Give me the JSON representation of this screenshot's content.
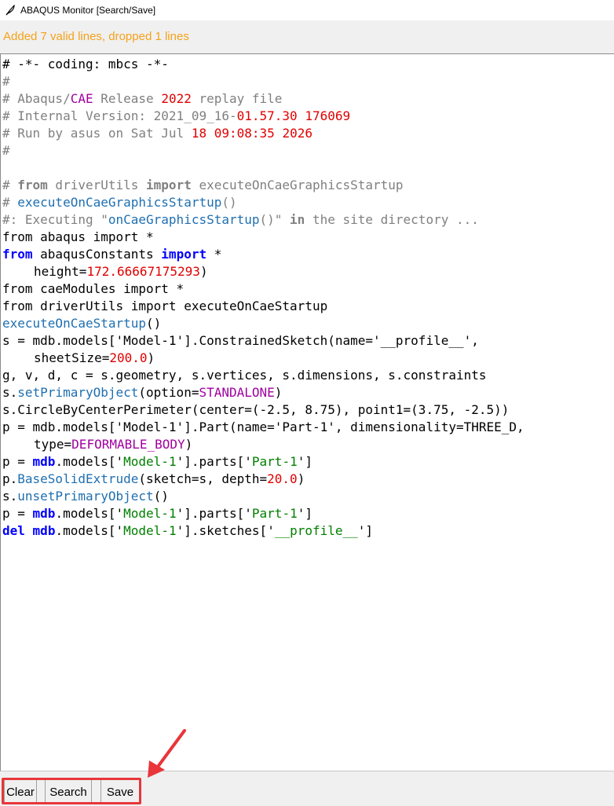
{
  "window": {
    "title": "ABAQUS Monitor [Search/Save]"
  },
  "status": {
    "text": "Added 7 valid lines, dropped 1 lines",
    "color": "#f5a21a"
  },
  "colors": {
    "comment": "#808080",
    "keyword": "#0000ff",
    "string": "#008000",
    "number": "#e00000",
    "function": "#1f6fb0",
    "constant": "#a000a0",
    "highlight_box": "#e8363a"
  },
  "editor": {
    "lines": [
      {
        "indent": false,
        "tokens": [
          {
            "t": "# -*- coding: mbcs -*-",
            "c": "plain"
          }
        ]
      },
      {
        "indent": false,
        "tokens": [
          {
            "t": "#",
            "c": "comment"
          }
        ]
      },
      {
        "indent": false,
        "tokens": [
          {
            "t": "# Abaqus/",
            "c": "comment"
          },
          {
            "t": "CAE",
            "c": "constant"
          },
          {
            "t": " Release ",
            "c": "comment"
          },
          {
            "t": "2022",
            "c": "number"
          },
          {
            "t": " replay file",
            "c": "comment"
          }
        ]
      },
      {
        "indent": false,
        "tokens": [
          {
            "t": "# Internal Version: 2021_09_16-",
            "c": "comment"
          },
          {
            "t": "01.57.30",
            "c": "number"
          },
          {
            "t": " ",
            "c": "comment"
          },
          {
            "t": "176069",
            "c": "number"
          }
        ]
      },
      {
        "indent": false,
        "tokens": [
          {
            "t": "# Run by asus on Sat Jul ",
            "c": "comment"
          },
          {
            "t": "18",
            "c": "number"
          },
          {
            "t": " ",
            "c": "comment"
          },
          {
            "t": "09:08:35",
            "c": "number"
          },
          {
            "t": " ",
            "c": "comment"
          },
          {
            "t": "2026",
            "c": "number"
          }
        ]
      },
      {
        "indent": false,
        "tokens": [
          {
            "t": "#",
            "c": "comment"
          }
        ]
      },
      {
        "indent": false,
        "tokens": [
          {
            "t": "",
            "c": "plain"
          }
        ]
      },
      {
        "indent": false,
        "tokens": [
          {
            "t": "# ",
            "c": "comment"
          },
          {
            "t": "from",
            "c": "comment-kw"
          },
          {
            "t": " driverUtils ",
            "c": "comment"
          },
          {
            "t": "import",
            "c": "comment-kw"
          },
          {
            "t": " executeOnCaeGraphicsStartup",
            "c": "comment"
          }
        ]
      },
      {
        "indent": false,
        "tokens": [
          {
            "t": "# ",
            "c": "comment"
          },
          {
            "t": "executeOnCaeGraphicsStartup",
            "c": "function"
          },
          {
            "t": "()",
            "c": "comment"
          }
        ]
      },
      {
        "indent": false,
        "tokens": [
          {
            "t": "#: Executing \"",
            "c": "comment"
          },
          {
            "t": "onCaeGraphicsStartup",
            "c": "function"
          },
          {
            "t": "()\" ",
            "c": "comment"
          },
          {
            "t": "in",
            "c": "comment-kw"
          },
          {
            "t": " the site directory ...",
            "c": "comment"
          }
        ]
      },
      {
        "indent": false,
        "tokens": [
          {
            "t": "from abaqus import *",
            "c": "plain"
          }
        ]
      },
      {
        "indent": false,
        "tokens": [
          {
            "t": "from",
            "c": "keyword"
          },
          {
            "t": " abaqusConstants ",
            "c": "plain"
          },
          {
            "t": "import",
            "c": "keyword"
          },
          {
            "t": " *",
            "c": "plain"
          }
        ]
      },
      {
        "indent": true,
        "tokens": [
          {
            "t": "height=",
            "c": "plain"
          },
          {
            "t": "172.66667175293",
            "c": "number"
          },
          {
            "t": ")",
            "c": "plain"
          }
        ]
      },
      {
        "indent": false,
        "tokens": [
          {
            "t": "from caeModules import *",
            "c": "plain"
          }
        ]
      },
      {
        "indent": false,
        "tokens": [
          {
            "t": "from driverUtils import executeOnCaeStartup",
            "c": "plain"
          }
        ]
      },
      {
        "indent": false,
        "tokens": [
          {
            "t": "executeOnCaeStartup",
            "c": "function"
          },
          {
            "t": "()",
            "c": "plain"
          }
        ]
      },
      {
        "indent": false,
        "tokens": [
          {
            "t": "s = mdb.models['Model-1'].ConstrainedSketch(name='__profile__',",
            "c": "plain"
          }
        ]
      },
      {
        "indent": true,
        "tokens": [
          {
            "t": "sheetSize=",
            "c": "plain"
          },
          {
            "t": "200.0",
            "c": "number"
          },
          {
            "t": ")",
            "c": "plain"
          }
        ]
      },
      {
        "indent": false,
        "tokens": [
          {
            "t": "g, v, d, c = s.geometry, s.vertices, s.dimensions, s.constraints",
            "c": "plain"
          }
        ]
      },
      {
        "indent": false,
        "tokens": [
          {
            "t": "s.",
            "c": "plain"
          },
          {
            "t": "setPrimaryObject",
            "c": "function"
          },
          {
            "t": "(option=",
            "c": "plain"
          },
          {
            "t": "STANDALONE",
            "c": "constant"
          },
          {
            "t": ")",
            "c": "plain"
          }
        ]
      },
      {
        "indent": false,
        "tokens": [
          {
            "t": "s.CircleByCenterPerimeter(center=(-2.5, 8.75), point1=(3.75, -2.5))",
            "c": "plain"
          }
        ]
      },
      {
        "indent": false,
        "tokens": [
          {
            "t": "p = mdb.models['Model-1'].Part(name='Part-1', dimensionality=THREE_D,",
            "c": "plain"
          }
        ]
      },
      {
        "indent": true,
        "tokens": [
          {
            "t": "type=",
            "c": "plain"
          },
          {
            "t": "DEFORMABLE_BODY",
            "c": "constant"
          },
          {
            "t": ")",
            "c": "plain"
          }
        ]
      },
      {
        "indent": false,
        "tokens": [
          {
            "t": "p = ",
            "c": "plain"
          },
          {
            "t": "mdb",
            "c": "keyword"
          },
          {
            "t": ".models['",
            "c": "plain"
          },
          {
            "t": "Model-1",
            "c": "string"
          },
          {
            "t": "'].parts['",
            "c": "plain"
          },
          {
            "t": "Part-1",
            "c": "string"
          },
          {
            "t": "']",
            "c": "plain"
          }
        ]
      },
      {
        "indent": false,
        "tokens": [
          {
            "t": "p.",
            "c": "plain"
          },
          {
            "t": "BaseSolidExtrude",
            "c": "function"
          },
          {
            "t": "(sketch=s, depth=",
            "c": "plain"
          },
          {
            "t": "20.0",
            "c": "number"
          },
          {
            "t": ")",
            "c": "plain"
          }
        ]
      },
      {
        "indent": false,
        "tokens": [
          {
            "t": "s.",
            "c": "plain"
          },
          {
            "t": "unsetPrimaryObject",
            "c": "function"
          },
          {
            "t": "()",
            "c": "plain"
          }
        ]
      },
      {
        "indent": false,
        "tokens": [
          {
            "t": "p = ",
            "c": "plain"
          },
          {
            "t": "mdb",
            "c": "keyword"
          },
          {
            "t": ".models['",
            "c": "plain"
          },
          {
            "t": "Model-1",
            "c": "string"
          },
          {
            "t": "'].parts['",
            "c": "plain"
          },
          {
            "t": "Part-1",
            "c": "string"
          },
          {
            "t": "']",
            "c": "plain"
          }
        ]
      },
      {
        "indent": false,
        "tokens": [
          {
            "t": "del",
            "c": "keyword"
          },
          {
            "t": " ",
            "c": "plain"
          },
          {
            "t": "mdb",
            "c": "keyword"
          },
          {
            "t": ".models['",
            "c": "plain"
          },
          {
            "t": "Model-1",
            "c": "string"
          },
          {
            "t": "'].sketches['",
            "c": "plain"
          },
          {
            "t": "__profile__",
            "c": "string"
          },
          {
            "t": "']",
            "c": "plain"
          }
        ]
      }
    ]
  },
  "buttons": {
    "clear": "Clear",
    "search": "Search",
    "save": "Save"
  },
  "icons": {
    "app": "feather-icon",
    "annotation": "arrow-icon"
  }
}
